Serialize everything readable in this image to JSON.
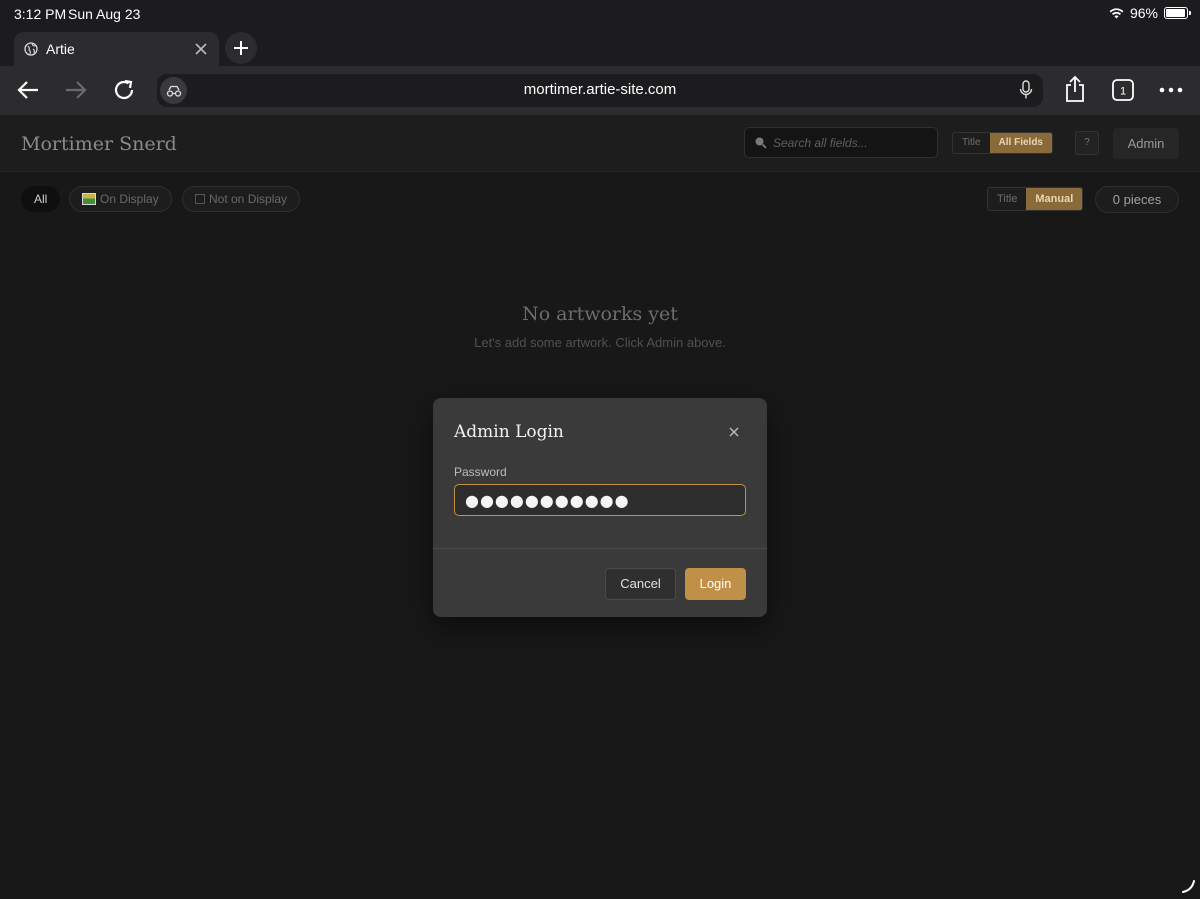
{
  "status_bar": {
    "time": "3:12 PM",
    "date": "Sun Aug 23",
    "battery": "96%",
    "battery_level": 0.96
  },
  "browser": {
    "tab": {
      "title": "Artie"
    },
    "url": "mortimer.artie-site.com",
    "tab_count": "1",
    "icons": [
      "back-icon",
      "forward-icon",
      "reload-icon",
      "site-settings-icon",
      "microphone-icon",
      "share-icon",
      "tabs-icon",
      "more-icon"
    ]
  },
  "app": {
    "brand": "Mortimer Snerd",
    "search": {
      "placeholder": "Search all fields..."
    },
    "search_scope": {
      "title": "Title",
      "all_fields": "All Fields",
      "selected": "All Fields"
    },
    "help_label": "?",
    "admin_label": "Admin",
    "filters": {
      "all": "All",
      "on_display": "On Display",
      "not_on_display": "Not on Display",
      "selected": "All"
    },
    "sort": {
      "title": "Title",
      "manual": "Manual",
      "selected": "Manual"
    },
    "pieces_count": "0 pieces",
    "empty_state": {
      "title": "No artworks yet",
      "subtitle": "Let's add some artwork. Click Admin above."
    },
    "accent_color": "#c08f48"
  },
  "login_modal": {
    "title": "Admin Login",
    "password_label": "Password",
    "password_value": "●●●●●●●●●●●",
    "cancel_label": "Cancel",
    "login_label": "Login"
  }
}
